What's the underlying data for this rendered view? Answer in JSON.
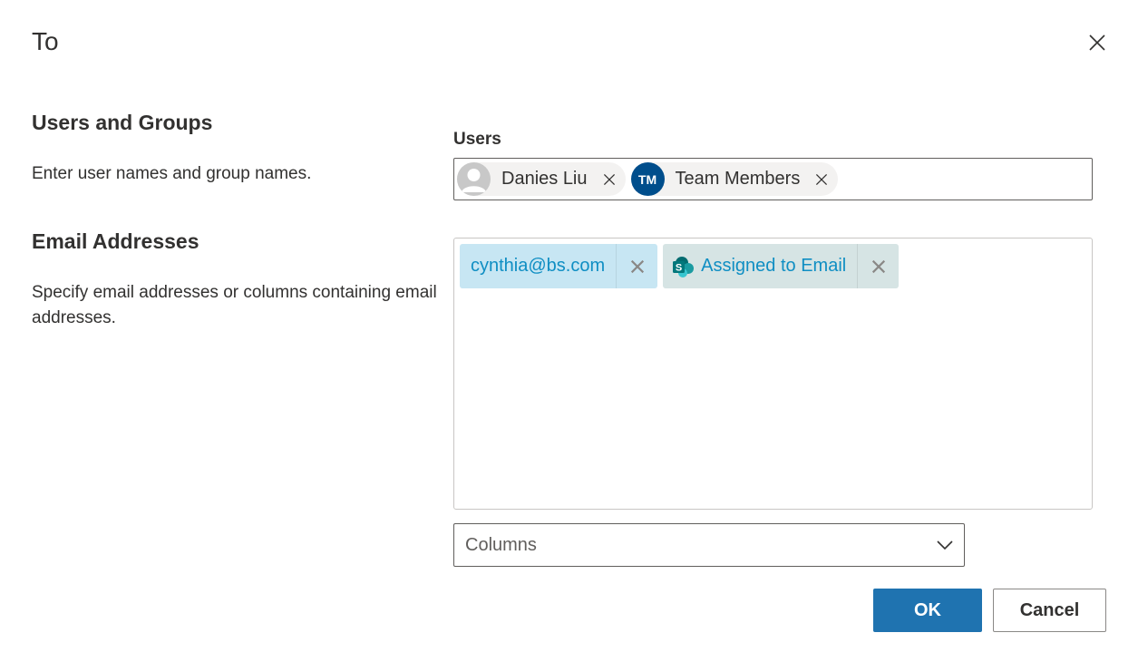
{
  "dialog": {
    "title": "To"
  },
  "users_groups": {
    "title": "Users and Groups",
    "description": "Enter user names and group names.",
    "field_label": "Users",
    "people": [
      {
        "name": "Danies Liu",
        "avatar": "person-photo-icon"
      },
      {
        "name": "Team Members",
        "initials": "TM",
        "avatar_color": "#004e8c"
      }
    ]
  },
  "email_addresses": {
    "title": "Email Addresses",
    "description": "Specify email addresses or columns containing email addresses.",
    "tokens": [
      {
        "label": "cynthia@bs.com",
        "type": "email"
      },
      {
        "label": "Assigned to Email",
        "type": "column",
        "icon": "sharepoint-icon"
      }
    ]
  },
  "columns_select": {
    "value": "Columns"
  },
  "buttons": {
    "ok": "OK",
    "cancel": "Cancel"
  },
  "colors": {
    "accent": "#1f73b0",
    "token_text": "#0f8ec3",
    "avatar": "#004e8c"
  }
}
